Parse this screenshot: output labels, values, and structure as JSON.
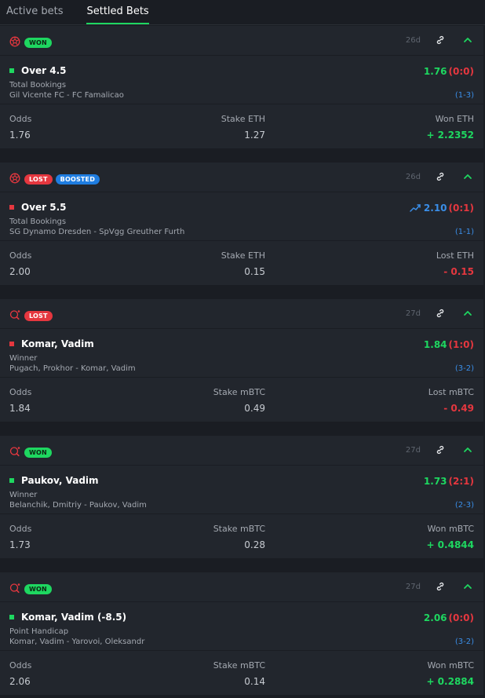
{
  "tabs": [
    {
      "label": "Active bets",
      "active": false
    },
    {
      "label": "Settled Bets",
      "active": true
    }
  ],
  "colors": {
    "won": "#1ed760",
    "lost": "#e5373f",
    "boosted": "#1f7de0",
    "card": "#22262d",
    "bg": "#1a1d23"
  },
  "bets": [
    {
      "sport_icon": "football-icon",
      "badges": [
        {
          "label": "WON",
          "type": "won"
        }
      ],
      "age": "26d",
      "selection": "Over 4.5",
      "status_dot": "green",
      "market": "Total Bookings",
      "event": "Gil Vicente FC - FC Famalicao",
      "odds": "1.76",
      "boosted": false,
      "score": "(0:0)",
      "set_score": "(1-3)",
      "odds_label": "Odds",
      "odds_value": "1.76",
      "stake_label": "Stake ETH",
      "stake_value": "1.27",
      "result_label": "Won ETH",
      "result_value": "+ 2.2352",
      "result_type": "win"
    },
    {
      "sport_icon": "football-icon",
      "badges": [
        {
          "label": "LOST",
          "type": "lost"
        },
        {
          "label": "BOOSTED",
          "type": "boosted"
        }
      ],
      "age": "26d",
      "selection": "Over 5.5",
      "status_dot": "red",
      "market": "Total Bookings",
      "event": "SG Dynamo Dresden - SpVgg Greuther Furth",
      "odds": "2.10",
      "boosted": true,
      "score": "(0:1)",
      "set_score": "(1-1)",
      "odds_label": "Odds",
      "odds_value": "2.00",
      "stake_label": "Stake ETH",
      "stake_value": "0.15",
      "result_label": "Lost ETH",
      "result_value": "- 0.15",
      "result_type": "loss"
    },
    {
      "sport_icon": "table-tennis-icon",
      "badges": [
        {
          "label": "LOST",
          "type": "lost"
        }
      ],
      "age": "27d",
      "selection": "Komar, Vadim",
      "status_dot": "red",
      "market": "Winner",
      "event": "Pugach, Prokhor - Komar, Vadim",
      "odds": "1.84",
      "boosted": false,
      "score": "(1:0)",
      "set_score": "(3-2)",
      "odds_label": "Odds",
      "odds_value": "1.84",
      "stake_label": "Stake mBTC",
      "stake_value": "0.49",
      "result_label": "Lost mBTC",
      "result_value": "- 0.49",
      "result_type": "loss"
    },
    {
      "sport_icon": "table-tennis-icon",
      "badges": [
        {
          "label": "WON",
          "type": "won"
        }
      ],
      "age": "27d",
      "selection": "Paukov, Vadim",
      "status_dot": "green",
      "market": "Winner",
      "event": "Belanchik, Dmitriy - Paukov, Vadim",
      "odds": "1.73",
      "boosted": false,
      "score": "(2:1)",
      "set_score": "(2-3)",
      "odds_label": "Odds",
      "odds_value": "1.73",
      "stake_label": "Stake mBTC",
      "stake_value": "0.28",
      "result_label": "Won mBTC",
      "result_value": "+ 0.4844",
      "result_type": "win"
    },
    {
      "sport_icon": "table-tennis-icon",
      "badges": [
        {
          "label": "WON",
          "type": "won"
        }
      ],
      "age": "27d",
      "selection": "Komar, Vadim (-8.5)",
      "status_dot": "green",
      "market": "Point Handicap",
      "event": "Komar, Vadim - Yarovoi, Oleksandr",
      "odds": "2.06",
      "boosted": false,
      "score": "(0:0)",
      "set_score": "(3-2)",
      "odds_label": "Odds",
      "odds_value": "2.06",
      "stake_label": "Stake mBTC",
      "stake_value": "0.14",
      "result_label": "Won mBTC",
      "result_value": "+ 0.2884",
      "result_type": "win"
    }
  ]
}
